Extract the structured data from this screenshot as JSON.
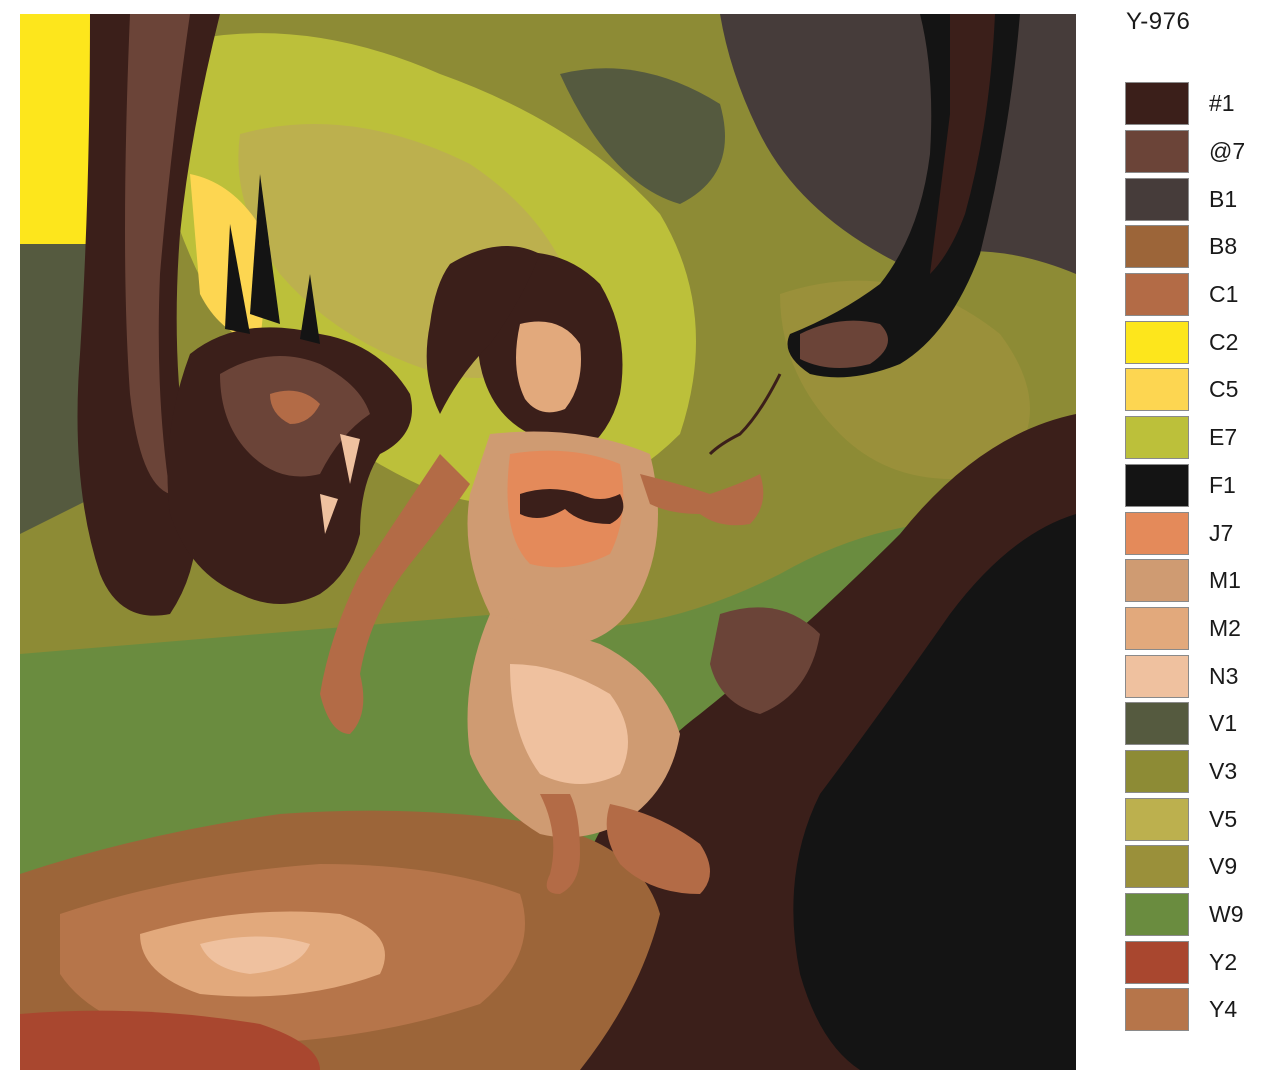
{
  "product_code": "Y-976",
  "palette": [
    {
      "label": "#1",
      "color": "#3b1f1a"
    },
    {
      "label": "@7",
      "color": "#6b4438"
    },
    {
      "label": "B1",
      "color": "#463c3a"
    },
    {
      "label": "B8",
      "color": "#9c6539"
    },
    {
      "label": "C1",
      "color": "#b36b46"
    },
    {
      "label": "C2",
      "color": "#fde61c"
    },
    {
      "label": "C5",
      "color": "#fdd651"
    },
    {
      "label": "E7",
      "color": "#bcc03a"
    },
    {
      "label": "F1",
      "color": "#141414"
    },
    {
      "label": "J7",
      "color": "#e48a5a"
    },
    {
      "label": "M1",
      "color": "#cf9b72"
    },
    {
      "label": "M2",
      "color": "#e2a97c"
    },
    {
      "label": "N3",
      "color": "#efc19f"
    },
    {
      "label": "V1",
      "color": "#555a3f"
    },
    {
      "label": "V3",
      "color": "#8d8b35"
    },
    {
      "label": "V5",
      "color": "#bcb04e"
    },
    {
      "label": "V9",
      "color": "#9a903a"
    },
    {
      "label": "W9",
      "color": "#6a8c3f"
    },
    {
      "label": "Y2",
      "color": "#a9472f"
    },
    {
      "label": "Y4",
      "color": "#b6754a"
    }
  ]
}
